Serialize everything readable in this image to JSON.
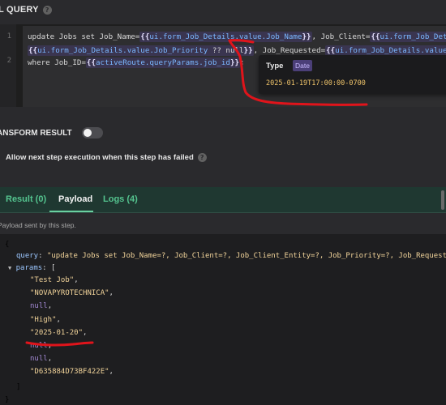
{
  "section": {
    "title": "L QUERY",
    "help_icon": "?"
  },
  "editor": {
    "line_numbers": [
      "1",
      "2"
    ],
    "line1": {
      "p1": "update Jobs set Job_Name=",
      "t1_open": "{{",
      "t1_expr": "ui.form_Job_Details.value.Job_Name",
      "t1_close": "}}",
      "p2": ", Job_Client=",
      "t2_open": "{{",
      "t2_expr": "ui.form_Job_Details.value.Job_C"
    },
    "line1b": {
      "t3_open": "{{",
      "t3_expr": "ui.form_Job_Details.value.Job_Priority",
      "t3_op": " ?? null",
      "t3_close": "}}",
      "p3": ", Job_Requested=",
      "t4_open": "{{",
      "t4_expr": "ui.form_Job_Details.value.Job_Requested"
    },
    "line2": {
      "p1": "where Job_ID=",
      "t1_open": "{{",
      "t1_expr": "activeRoute.queryParams.job_id",
      "t1_close": "}}",
      "p2": ";"
    }
  },
  "tooltip": {
    "label": "Type",
    "badge": "Date",
    "value": "2025-01-19T17:00:00-0700",
    "copy_icon": "⧉"
  },
  "transform": {
    "label": "ANSFORM RESULT",
    "enabled": false
  },
  "allow_next": {
    "label": "Allow next step execution when this step has failed",
    "help_icon": "?"
  },
  "tabs": [
    {
      "label": "Result (0)",
      "active": false
    },
    {
      "label": "Payload",
      "active": true
    },
    {
      "label": "Logs (4)",
      "active": false
    }
  ],
  "payload_caption": "Payload sent by this step.",
  "payload": {
    "open_brace": "{",
    "query_key": "query",
    "query_value": "\"update Jobs set Job_Name=?, Job_Client=?, Job_Client_Entity=?, Job_Priority=?, Job_Requested=",
    "params_key": "params",
    "params_open": "[",
    "params": [
      {
        "text": "\"Test Job\"",
        "kind": "str"
      },
      {
        "text": "\"NOVAPYROTECHNICA\"",
        "kind": "str"
      },
      {
        "text": "null",
        "kind": "null"
      },
      {
        "text": "\"High\"",
        "kind": "str"
      },
      {
        "text": "\"2025-01-20\"",
        "kind": "str"
      },
      {
        "text": "null",
        "kind": "null"
      },
      {
        "text": "null",
        "kind": "null"
      },
      {
        "text": "\"D635884D73BF422E\"",
        "kind": "str"
      }
    ],
    "params_close": "]",
    "close_brace": "}"
  },
  "colors": {
    "annotation_red": "#e0141b",
    "tab_green": "#54c48f",
    "template_bg": "#3a3550"
  }
}
